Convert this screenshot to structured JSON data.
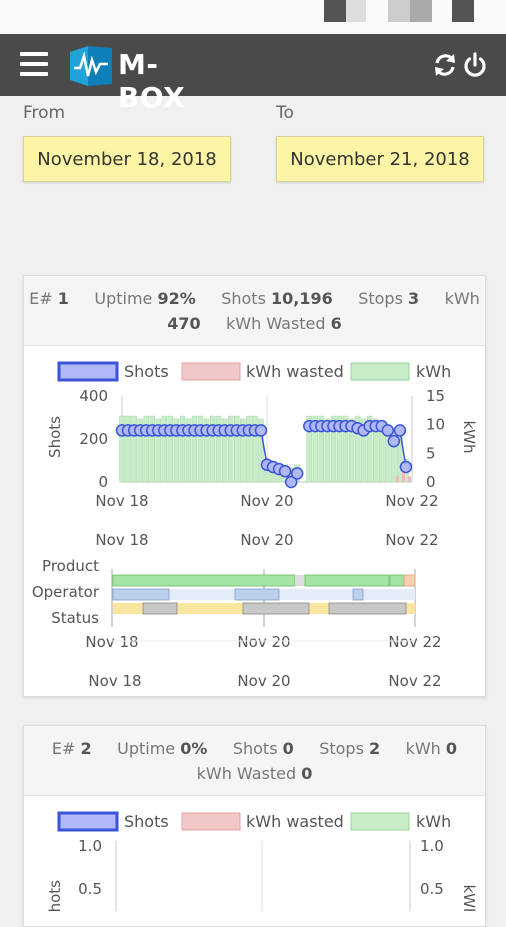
{
  "app": {
    "logo_text": "M-BOX"
  },
  "icons": {
    "menu": "hamburger-menu-icon",
    "refresh": "refresh-icon",
    "power": "power-icon"
  },
  "dates": {
    "from_label": "From",
    "to_label": "To",
    "from_value": "November 18, 2018",
    "to_value": "November 21, 2018"
  },
  "machines": [
    {
      "label": "E#",
      "number": "1",
      "uptime_label": "Uptime",
      "uptime": "92%",
      "shots_label": "Shots",
      "shots": "10,196",
      "stops_label": "Stops",
      "stops": "3",
      "kwh_label": "kWh",
      "kwh": "470",
      "kwh_wasted_label": "kWh Wasted",
      "kwh_wasted": "6"
    },
    {
      "label": "E#",
      "number": "2",
      "uptime_label": "Uptime",
      "uptime": "0%",
      "shots_label": "Shots",
      "shots": "0",
      "stops_label": "Stops",
      "stops": "2",
      "kwh_label": "kWh",
      "kwh": "0",
      "kwh_wasted_label": "kWh Wasted",
      "kwh_wasted": "0"
    }
  ],
  "legend": {
    "shots": "Shots",
    "kwh_wasted": "kWh wasted",
    "kwh": "kWh"
  },
  "colors": {
    "shots": "#3b55d9",
    "shots_fill": "#b0b8f5",
    "kwh_wasted": "#f0b8b8",
    "kwh": "#bfe5bf",
    "product": "#a3e6a3",
    "operator": "#bcd0ec",
    "status_yellow": "#fbe6a0",
    "status_grey": "#c8c8c8",
    "date_field": "#fdf5a6"
  },
  "timeline": {
    "tick_labels": [
      "Nov 18",
      "Nov 20",
      "Nov 22"
    ],
    "rows": [
      "Product",
      "Operator",
      "Status"
    ]
  },
  "chart_data": [
    {
      "type": "bar",
      "title": "",
      "ylabel": "Shots",
      "y2label": "kWh",
      "ylim": [
        0,
        400
      ],
      "y2lim": [
        0,
        15
      ],
      "yticks": [
        "400",
        "200",
        "0"
      ],
      "y2ticks": [
        "15",
        "10",
        "5",
        "0"
      ],
      "xticks": [
        "Nov 18",
        "Nov 20",
        "Nov 22"
      ],
      "xlim": [
        0,
        96
      ],
      "series": [
        {
          "name": "Shots",
          "kind": "scatter-line",
          "x": [
            0,
            2,
            4,
            6,
            8,
            10,
            12,
            14,
            16,
            18,
            20,
            22,
            24,
            26,
            28,
            30,
            32,
            34,
            36,
            38,
            40,
            42,
            44,
            46,
            48,
            50,
            52,
            54,
            56,
            58,
            62,
            64,
            66,
            68,
            70,
            72,
            74,
            76,
            78,
            80,
            82,
            84,
            86,
            88,
            90,
            92,
            94
          ],
          "values": [
            240,
            240,
            240,
            240,
            240,
            240,
            240,
            240,
            240,
            240,
            240,
            240,
            240,
            240,
            240,
            240,
            240,
            240,
            240,
            240,
            240,
            240,
            240,
            240,
            80,
            70,
            60,
            50,
            0,
            40,
            260,
            260,
            260,
            260,
            260,
            260,
            260,
            260,
            250,
            240,
            260,
            260,
            260,
            240,
            190,
            240,
            70
          ]
        },
        {
          "name": "kWh wasted",
          "kind": "bar",
          "x": [
            90,
            92,
            94
          ],
          "values": [
            1,
            2,
            1
          ]
        },
        {
          "name": "kWh",
          "kind": "bar",
          "x": [
            0,
            2,
            4,
            6,
            8,
            10,
            12,
            14,
            16,
            18,
            20,
            22,
            24,
            26,
            28,
            30,
            32,
            34,
            36,
            38,
            40,
            42,
            44,
            46,
            48,
            50,
            52,
            54,
            56,
            58,
            62,
            64,
            66,
            68,
            70,
            72,
            74,
            76,
            78,
            80,
            82,
            84,
            86,
            88,
            90,
            92,
            94
          ],
          "values": [
            11.5,
            11.5,
            11.5,
            11,
            11.5,
            11.5,
            11,
            11.5,
            11.5,
            11,
            11.5,
            11,
            11.5,
            11.5,
            11,
            11.5,
            11.5,
            11,
            11.5,
            11.5,
            11,
            11.5,
            11.5,
            11,
            2,
            2,
            3,
            3,
            2.5,
            3,
            11.5,
            11.5,
            11.5,
            11,
            11.5,
            11.5,
            11.5,
            11,
            11.5,
            11,
            11.5,
            11,
            10,
            9.5,
            9,
            8,
            4
          ]
        }
      ]
    },
    {
      "type": "bar",
      "title": "",
      "ylabel": "Shots",
      "y2label": "kWh",
      "ylim": [
        0,
        1.0
      ],
      "y2lim": [
        0,
        1.0
      ],
      "yticks": [
        "1.0",
        "0.5"
      ],
      "y2ticks": [
        "1.0",
        "0.5"
      ],
      "xticks": [],
      "series": [
        {
          "name": "Shots",
          "values": []
        },
        {
          "name": "kWh wasted",
          "values": []
        },
        {
          "name": "kWh",
          "values": []
        }
      ]
    }
  ]
}
